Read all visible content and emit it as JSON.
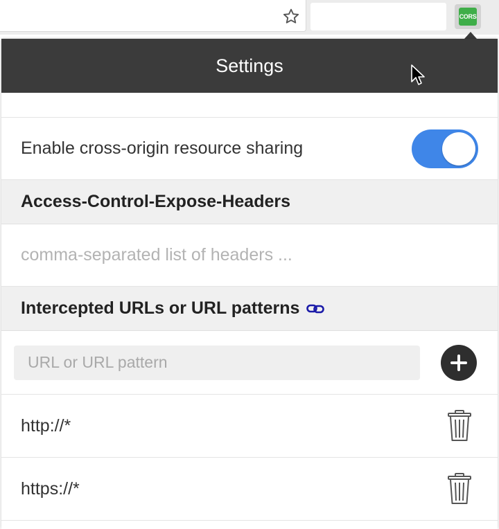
{
  "browser": {
    "extension_badge": "CORS"
  },
  "popup": {
    "title": "Settings",
    "enable_label": "Enable cross-origin resource sharing",
    "enable_on": true,
    "expose_headers": {
      "heading": "Access-Control-Expose-Headers",
      "placeholder": "comma-separated list of headers ...",
      "value": ""
    },
    "intercepted": {
      "heading": "Intercepted URLs or URL patterns",
      "input_placeholder": "URL or URL pattern",
      "patterns": [
        "http://*",
        "https://*"
      ]
    }
  },
  "colors": {
    "header_bg": "#3b3b3b",
    "toggle_on": "#3f86e8",
    "badge_green": "#3fae49",
    "link_blue": "#1a1aa8"
  },
  "icons": [
    "star-icon",
    "cors-extension-icon",
    "cursor-icon",
    "link-icon",
    "plus-icon",
    "trash-icon"
  ]
}
